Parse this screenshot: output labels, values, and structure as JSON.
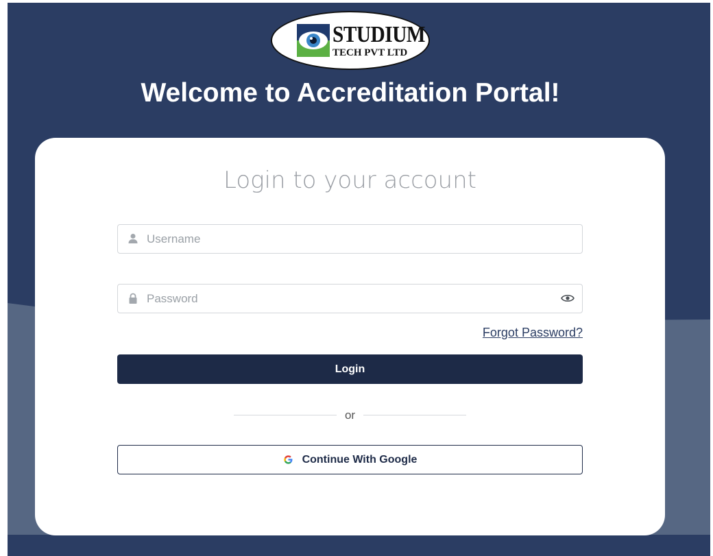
{
  "header": {
    "logo": {
      "name": "STUDIUM",
      "subtitle": "TECH PVT LTD",
      "icon": "eye-icon"
    },
    "welcome": "Welcome to Accreditation Portal!"
  },
  "login_card": {
    "title": "Login to your account",
    "username": {
      "placeholder": "Username",
      "value": "",
      "icon": "user-icon"
    },
    "password": {
      "placeholder": "Password",
      "value": "",
      "icon": "lock-icon",
      "toggle_icon": "eye-icon"
    },
    "forgot_password": "Forgot Password?",
    "login_button": "Login",
    "divider": "or",
    "google_button": {
      "label": "Continue With Google",
      "icon": "google-icon"
    }
  },
  "colors": {
    "background_dark": "#2b3d63",
    "background_light": "#566783",
    "button_primary": "#1d2a47",
    "card": "#ffffff"
  }
}
